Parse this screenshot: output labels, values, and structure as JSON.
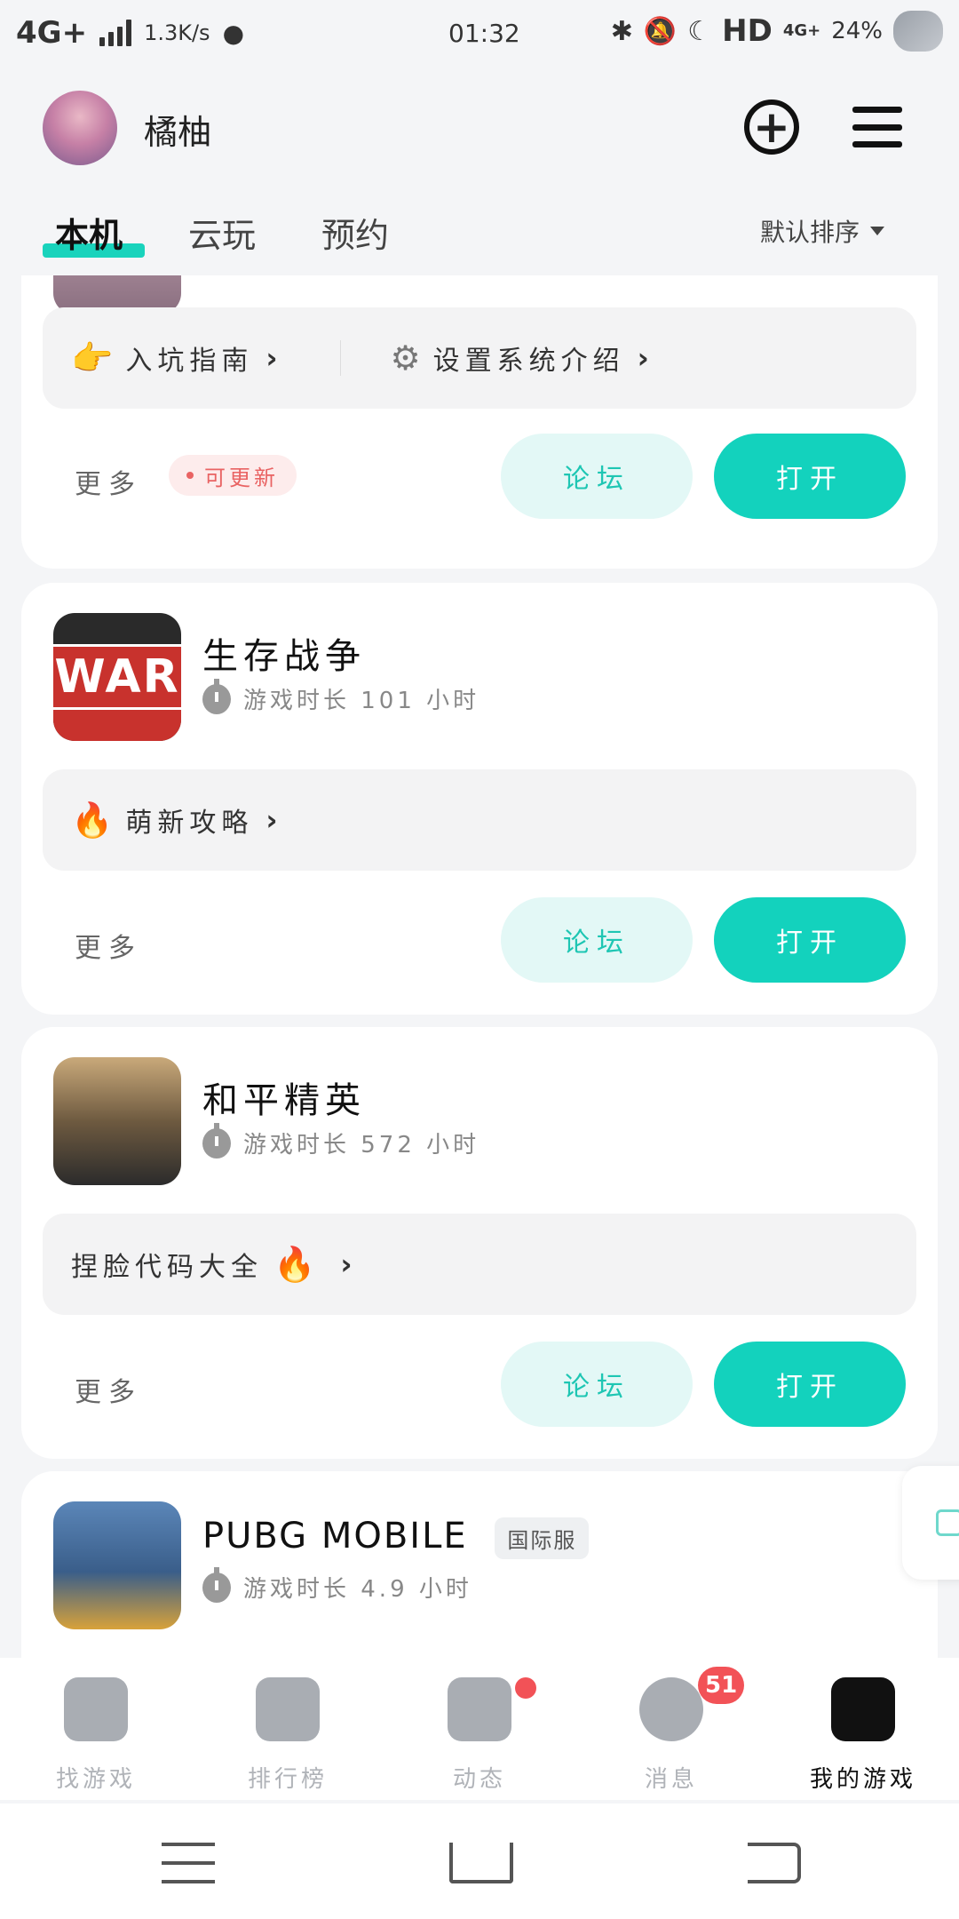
{
  "status_bar": {
    "network": "4G+",
    "speed": "1.3K/s",
    "time": "01:32",
    "hd": "HD",
    "net_small": "4G+",
    "battery": "24%"
  },
  "header": {
    "username": "橘柚",
    "add_icon": "plus-circle-icon",
    "menu_icon": "hamburger-menu-icon"
  },
  "tabs": [
    {
      "label": "本机",
      "active": true
    },
    {
      "label": "云玩",
      "active": false
    },
    {
      "label": "预约",
      "active": false
    }
  ],
  "sort": {
    "label": "默认排序"
  },
  "cards": [
    {
      "tips": [
        {
          "emoji": "👉",
          "text": "入坑指南"
        },
        {
          "emoji": "⚙",
          "text": "设置系统介绍"
        }
      ],
      "more_label": "更多",
      "update_label": "可更新",
      "forum_label": "论坛",
      "open_label": "打开"
    },
    {
      "icon_text": "WAR",
      "name": "生存战争",
      "playtime": "游戏时长 101 小时",
      "tip_emoji": "🔥",
      "tip_text": "萌新攻略",
      "more_label": "更多",
      "forum_label": "论坛",
      "open_label": "打开"
    },
    {
      "name": "和平精英",
      "playtime": "游戏时长 572 小时",
      "tip_text": "捏脸代码大全",
      "tip_emoji": "🔥",
      "more_label": "更多",
      "forum_label": "论坛",
      "open_label": "打开"
    },
    {
      "name": "PUBG MOBILE",
      "tag": "国际服",
      "playtime": "游戏时长 4.9 小时"
    }
  ],
  "bottom_nav": [
    {
      "label": "找游戏",
      "active": false
    },
    {
      "label": "排行榜",
      "active": false
    },
    {
      "label": "动态",
      "active": false
    },
    {
      "label": "消息",
      "active": false,
      "badge": "51"
    },
    {
      "label": "我的游戏",
      "active": true
    }
  ],
  "colors": {
    "accent": "#13d2bd",
    "badge_red": "#f25257"
  }
}
